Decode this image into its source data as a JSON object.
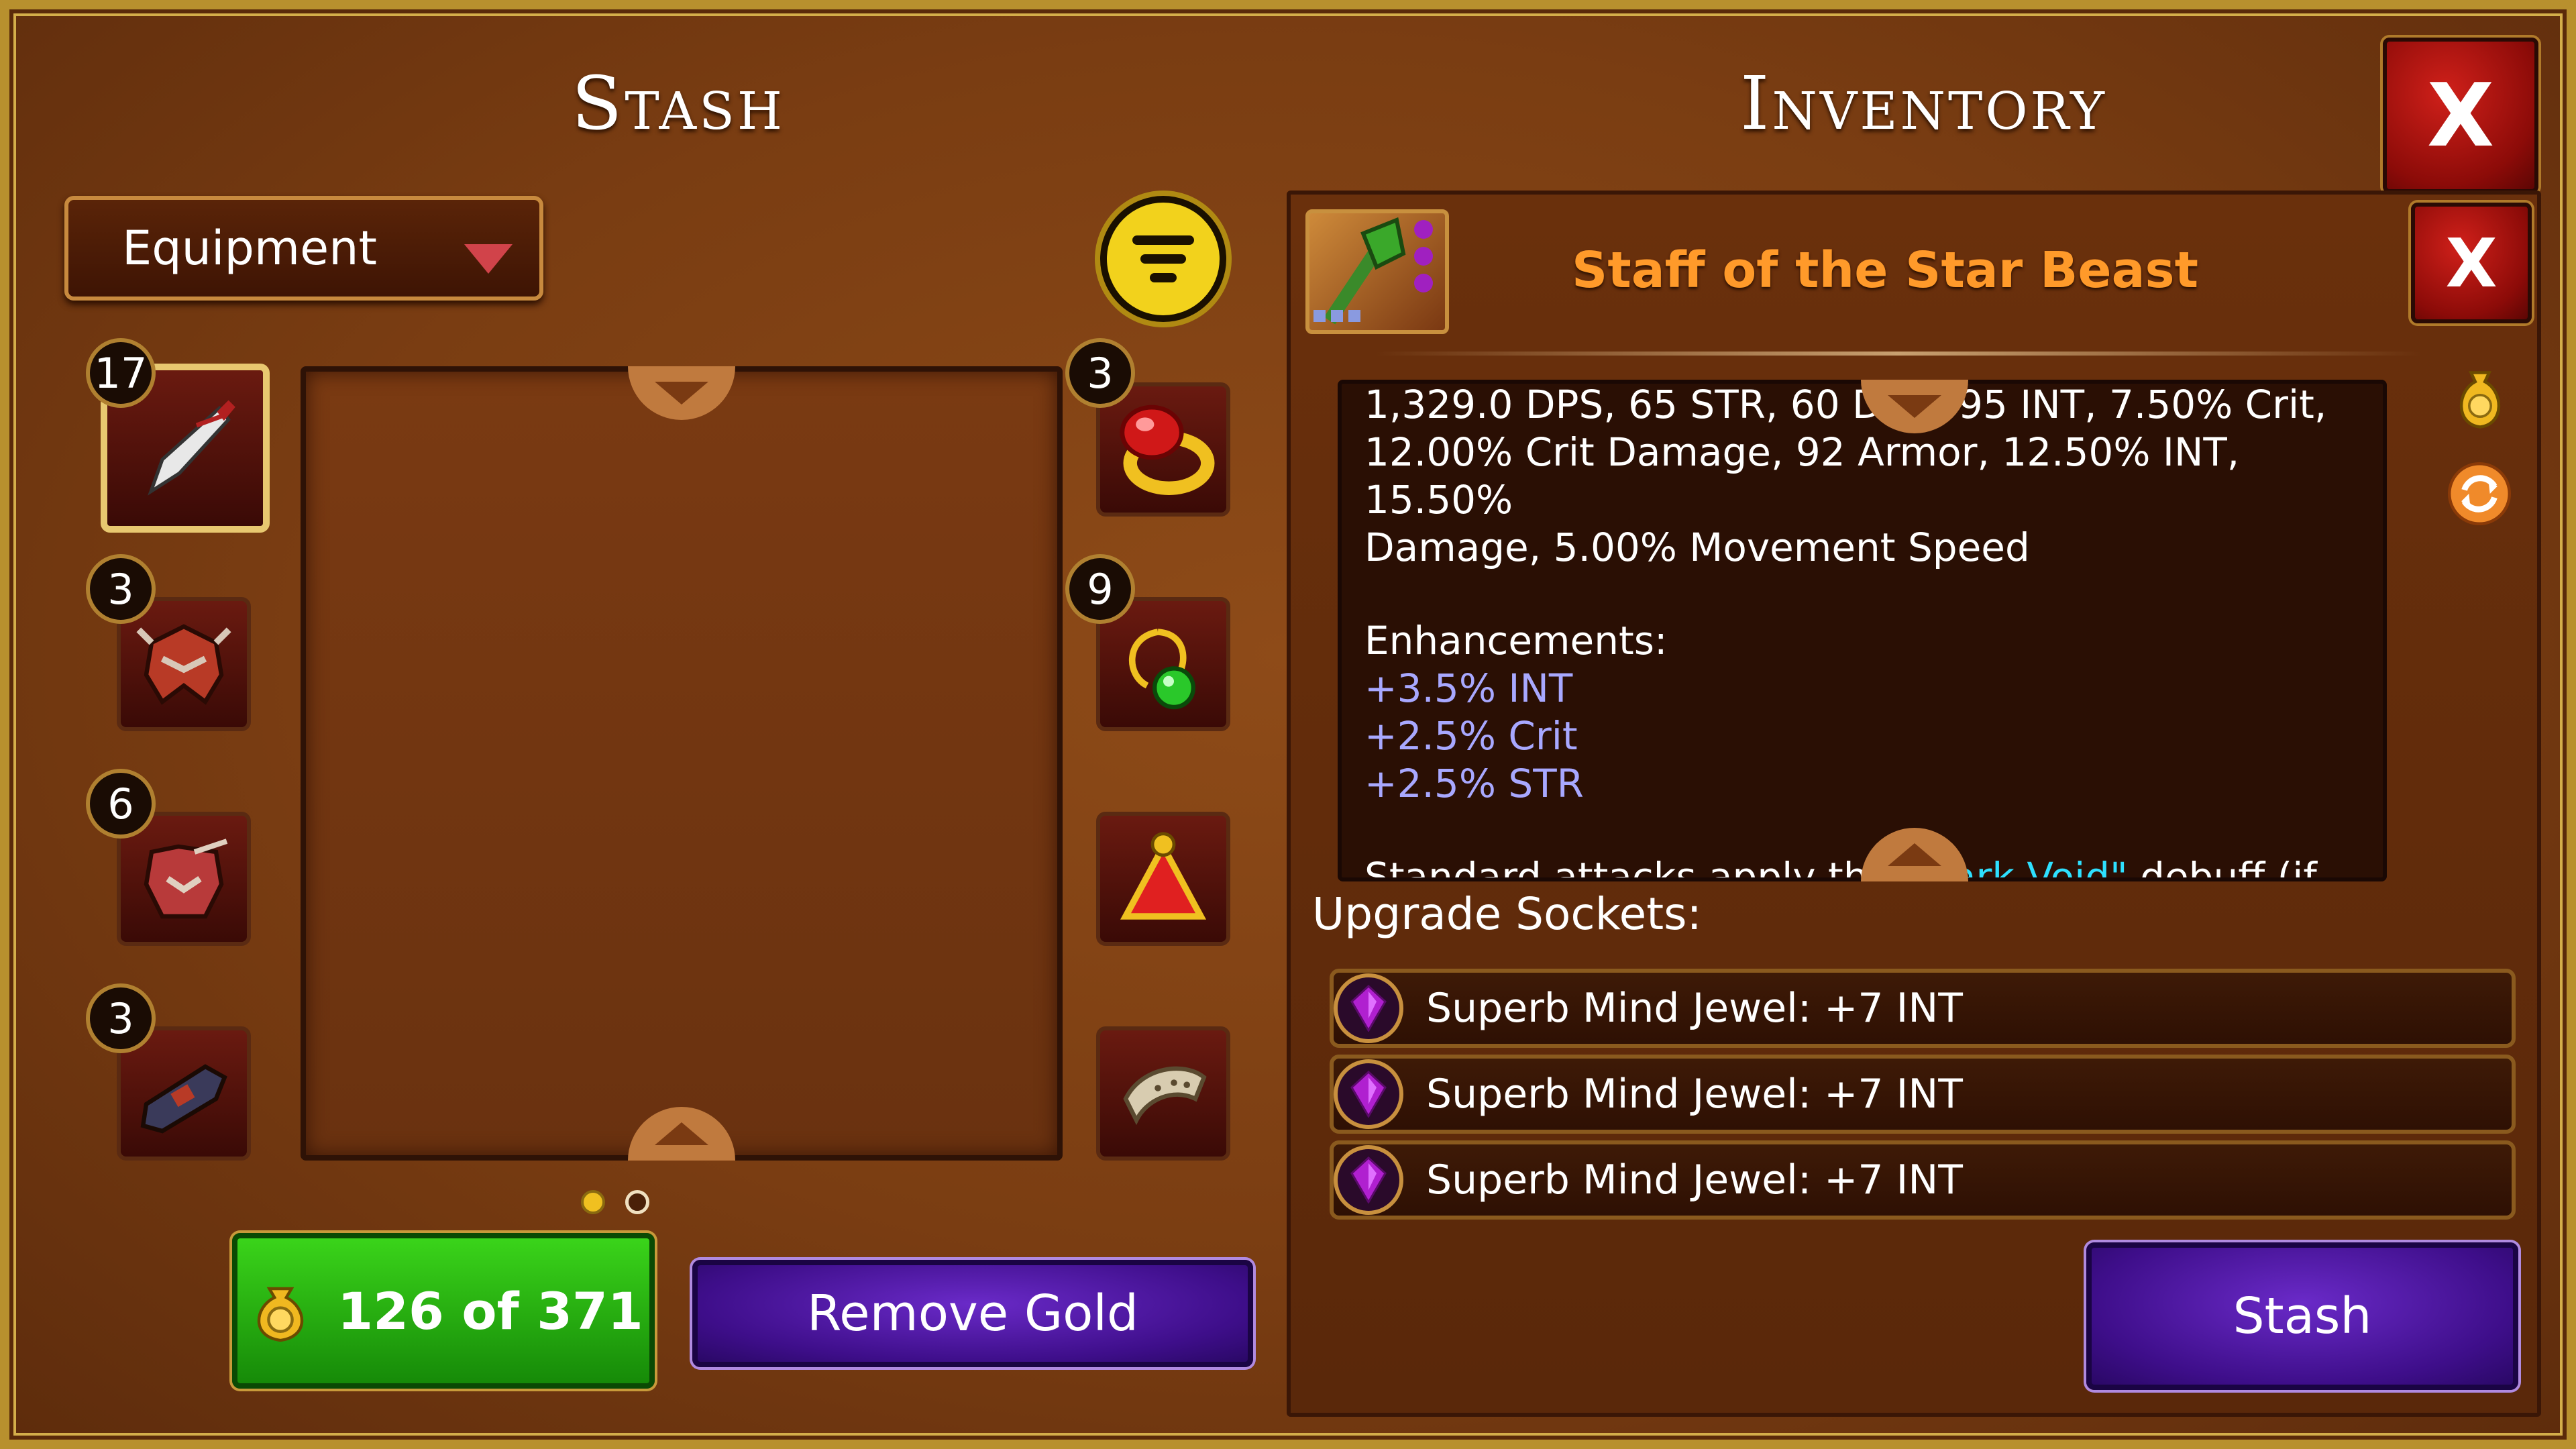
{
  "stash": {
    "title": "Stash",
    "category_dropdown": "Equipment",
    "slots_left": [
      {
        "count": "17",
        "item": "dagger"
      },
      {
        "count": "3",
        "item": "helmet"
      },
      {
        "count": "6",
        "item": "chest-armor"
      },
      {
        "count": "3",
        "item": "boots"
      }
    ],
    "slots_right": [
      {
        "count": "3",
        "item": "ring"
      },
      {
        "count": "9",
        "item": "amulet"
      },
      {
        "count": "",
        "item": "relic"
      },
      {
        "count": "",
        "item": "bracer"
      }
    ],
    "page": {
      "current": 1,
      "total": 2
    },
    "gold_label": "126 of 371",
    "remove_gold_label": "Remove Gold"
  },
  "inventory": {
    "title": "Inventory",
    "close_label": "X",
    "item": {
      "name": "Staff of the Star Beast",
      "close_label": "X",
      "stats_line1": "1,329.0 DPS, 65 STR, 60 DEX, 95 INT, 7.50% Crit,",
      "stats_line2": "12.00% Crit Damage, 92 Armor, 12.50% INT, 15.50%",
      "stats_line3": "Damage, 5.00% Movement Speed",
      "enhancements_label": "Enhancements:",
      "enhancements": [
        "+3.5% INT",
        "+2.5% Crit",
        "+2.5% STR"
      ],
      "effect_prefix": "Standard attacks apply the ",
      "effect_highlight": "\"Dark Void\"",
      "effect_suffix": " debuff (if"
    },
    "upgrade_sockets_label": "Upgrade Sockets:",
    "sockets": [
      "Superb Mind Jewel: +7 INT",
      "Superb Mind Jewel: +7 INT",
      "Superb Mind Jewel: +7 INT"
    ],
    "stash_button_label": "Stash"
  },
  "colors": {
    "item_name": "#ff9a2a",
    "enhancement": "#a8a8ff",
    "effect_highlight": "#2ee0ff",
    "gold_button": "#2cb814",
    "action_button": "#4a16a0",
    "close_button": "#b8140e"
  }
}
